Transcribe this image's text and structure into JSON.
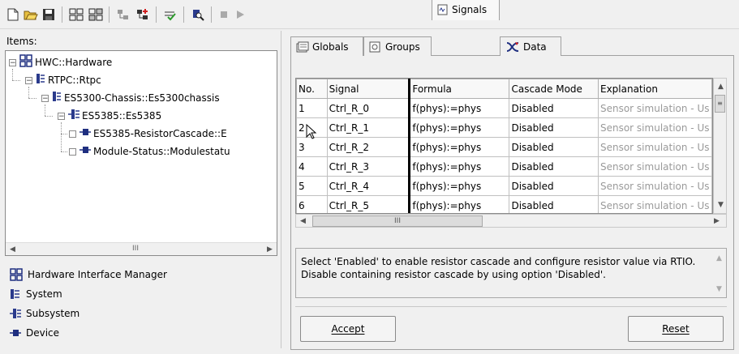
{
  "toolbar": {
    "buttons": [
      "new-icon",
      "open-icon",
      "save-icon",
      "group-icon",
      "ungroup-icon",
      "add-node-icon",
      "add-child-icon",
      "check-icon",
      "search-icon",
      "stop-icon",
      "play-icon"
    ]
  },
  "left": {
    "items_label": "Items:",
    "tree": {
      "n0": "HWC::Hardware",
      "n1": "RTPC::Rtpc",
      "n2": "ES5300-Chassis::Es5300chassis",
      "n3": "ES5385::Es5385",
      "n4": "ES5385-ResistorCascade::E",
      "n5": "Module-Status::Modulestatu"
    },
    "legend": {
      "hwm": "Hardware Interface Manager",
      "system": "System",
      "subsystem": "Subsystem",
      "device": "Device"
    }
  },
  "tabs": {
    "globals": "Globals",
    "groups": "Groups",
    "signals": "Signals",
    "data": "Data"
  },
  "grid": {
    "headers": [
      "No.",
      "Signal",
      "Formula",
      "Cascade Mode",
      "Explanation"
    ],
    "rows": [
      [
        "1",
        "Ctrl_R_0",
        "f(phys):=phys",
        "Disabled",
        "Sensor simulation - Us"
      ],
      [
        "2",
        "Ctrl_R_1",
        "f(phys):=phys",
        "Disabled",
        "Sensor simulation - Us"
      ],
      [
        "3",
        "Ctrl_R_2",
        "f(phys):=phys",
        "Disabled",
        "Sensor simulation - Us"
      ],
      [
        "4",
        "Ctrl_R_3",
        "f(phys):=phys",
        "Disabled",
        "Sensor simulation - Us"
      ],
      [
        "5",
        "Ctrl_R_4",
        "f(phys):=phys",
        "Disabled",
        "Sensor simulation - Us"
      ],
      [
        "6",
        "Ctrl_R_5",
        "f(phys):=phys",
        "Disabled",
        "Sensor simulation - Us"
      ]
    ]
  },
  "description": "Select 'Enabled' to enable resistor cascade and configure resistor value via RTIO. Disable containing resistor cascade by using option 'Disabled'.",
  "buttons": {
    "accept": "Accept",
    "reset": "Reset"
  },
  "colors": {
    "system": "#2a3a8c",
    "device": "#1f2f80"
  }
}
